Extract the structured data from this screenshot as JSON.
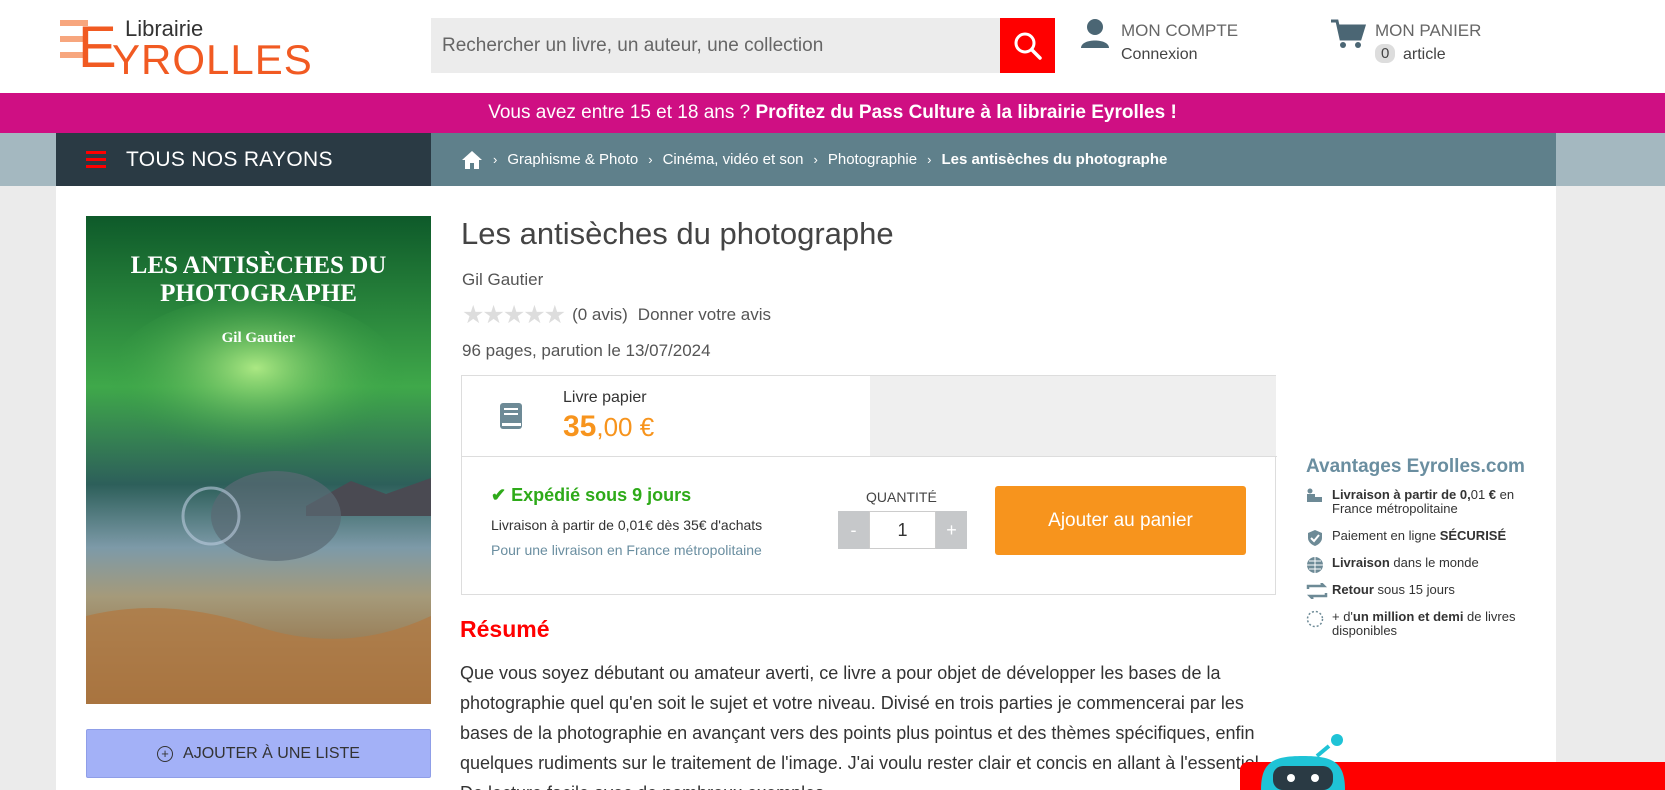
{
  "header": {
    "logo_small": "Librairie",
    "logo_big": "YROLLES",
    "logo_e": "E",
    "search_placeholder": "Rechercher un livre, un auteur, une collection",
    "account_title": "MON COMPTE",
    "account_sub": "Connexion",
    "cart_title": "MON PANIER",
    "cart_count": "0",
    "cart_sub": "article"
  },
  "promo": {
    "text": "Vous avez entre 15 et 18 ans ? ",
    "bold": "Profitez du Pass Culture à la librairie Eyrolles !"
  },
  "nav": {
    "rayons": "TOUS NOS RAYONS",
    "breadcrumbs": [
      "Graphisme & Photo",
      "Cinéma, vidéo et son",
      "Photographie"
    ],
    "current": "Les antisèches du photographe"
  },
  "product": {
    "cover_title_1": "LES ANTISÈCHES DU",
    "cover_title_2": "PHOTOGRAPHE",
    "cover_author": "Gil Gautier",
    "title": "Les antisèches du photographe",
    "author": "Gil Gautier",
    "reviews": "(0 avis)",
    "give_review": "Donner votre avis",
    "pages": "96 pages, parution le 13/07/2024",
    "format": "Livre papier",
    "price_int": "35",
    "price_dec": ",00 €",
    "shipping": "Expédié sous 9 jours",
    "shipping_info": "Livraison à partir de 0,01€ dès 35€ d'achats",
    "shipping_note": "Pour une livraison en France métropolitaine",
    "qty_label": "QUANTITÉ",
    "qty_minus": "-",
    "qty_value": "1",
    "qty_plus": "+",
    "add_to_cart": "Ajouter au panier",
    "add_to_list": "AJOUTER À UNE LISTE",
    "resume_title": "Résumé",
    "resume": "Que vous soyez débutant ou amateur averti, ce livre a pour objet de développer les bases de la photographie quel qu'en soit le sujet et votre niveau. Divisé en trois parties je commencerai par les bases de la photographie en avançant vers des points plus pointus et des thèmes spécifiques, enfin quelques rudiments sur le traitement de l'image. J'ai voulu rester clair et concis en allant à l'essentiel. De lecture facile avec de nombreux exemples"
  },
  "advantages": {
    "title": "Avantages Eyrolles.com",
    "r1_b": "Livraison à partir de 0,",
    "r1_n": "01",
    "r1_b2": " €",
    "r1_rest": " en France métropolitaine",
    "r2_pre": "Paiement en ligne ",
    "r2_b": "SÉCURISÉ",
    "r3_b": "Livraison",
    "r3_rest": " dans le monde",
    "r4_b": "Retour",
    "r4_rest": " sous 15 jours",
    "r5_pre": "+ d'",
    "r5_b": "un million et demi",
    "r5_rest": " de livres disponibles"
  },
  "colors": {
    "brand_orange": "#f15a22",
    "promo_pink": "#cf0f83",
    "price_orange": "#f7941d",
    "nav_dark": "#2a3a44",
    "breadcrumb_teal": "#5f808b",
    "ship_green": "#2eaa19",
    "resume_red": "#ff0000"
  }
}
